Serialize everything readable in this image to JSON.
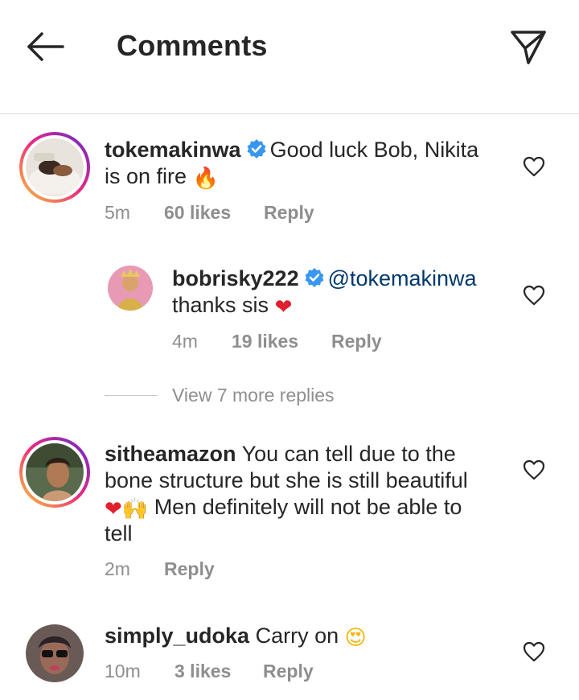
{
  "header": {
    "title": "Comments",
    "back_icon": "arrow-left-icon",
    "share_icon": "paper-plane-icon"
  },
  "comments": [
    {
      "username": "tokemakinwa",
      "verified": true,
      "text_line1": "Good luck Bob, Nikita",
      "text_line2": "is on fire",
      "emoji": "🔥",
      "time": "5m",
      "likes": "60 likes",
      "reply": "Reply"
    },
    {
      "username": "bobrisky222",
      "verified": true,
      "mention": "@tokemakinwa",
      "text_line2": "thanks sis",
      "emoji": "❤",
      "time": "4m",
      "likes": "19 likes",
      "reply": "Reply"
    },
    {
      "username": "sitheamazon",
      "text_line1": "You can tell due to the",
      "text_line2": "bone structure but she is still beautiful",
      "emoji": "❤🙌",
      "text_line3": "Men definitely will not be able to",
      "text_line4": "tell",
      "time": "2m",
      "reply": "Reply"
    },
    {
      "username": "simply_udoka",
      "text_line1": "Carry on",
      "emoji": "😍",
      "time": "10m",
      "likes": "3 likes",
      "reply": "Reply"
    }
  ],
  "view_more": "View 7 more replies",
  "colors": {
    "text": "#262626",
    "muted": "#8e8e8e",
    "mention": "#00376b",
    "verified": "#3897f0",
    "heart_red": "#e0202e",
    "divider": "#dbdbdb"
  }
}
